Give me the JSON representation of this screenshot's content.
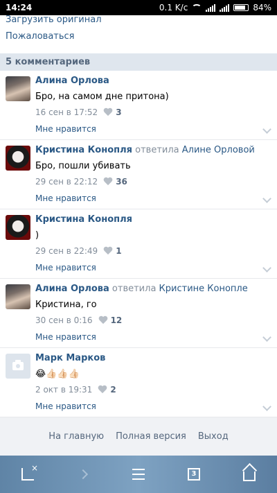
{
  "status_bar": {
    "time": "14:24",
    "speed": "0.1 K/c",
    "battery": "84%"
  },
  "top_links": {
    "upload": "Загрузить оригинал",
    "report": "Пожаловаться"
  },
  "comments_header": "5 комментариев",
  "comments": [
    {
      "author": "Алина Орлова",
      "reply_word": "",
      "reply_to": "",
      "text": "Бро, на самом дне притона)",
      "date": "16 сен в 17:52",
      "likes": "3",
      "like_label": "Мне нравится",
      "avatar": "alina"
    },
    {
      "author": "Кристина Конопля",
      "reply_word": "ответила",
      "reply_to": "Алине Орловой",
      "text": "Бро, пошли убивать",
      "date": "29 сен в 22:12",
      "likes": "36",
      "like_label": "Мне нравится",
      "avatar": "kristina"
    },
    {
      "author": "Кристина Конопля",
      "reply_word": "",
      "reply_to": "",
      "text": ")",
      "date": "29 сен в 22:49",
      "likes": "1",
      "like_label": "Мне нравится",
      "avatar": "kristina"
    },
    {
      "author": "Алина Орлова",
      "reply_word": "ответила",
      "reply_to": "Кристине Конопле",
      "text": "Кристина, го",
      "date": "30 сен в 0:16",
      "likes": "12",
      "like_label": "Мне нравится",
      "avatar": "alina"
    },
    {
      "author": "Марк Марков",
      "reply_word": "",
      "reply_to": "",
      "text": "😂👍🏻👍🏻👍🏻",
      "date": "2 окт в 19:31",
      "likes": "2",
      "like_label": "Мне нравится",
      "avatar": "mark"
    }
  ],
  "footer": {
    "home": "На главную",
    "full": "Полная версия",
    "logout": "Выход"
  },
  "navbar": {
    "tabs_count": "3"
  }
}
